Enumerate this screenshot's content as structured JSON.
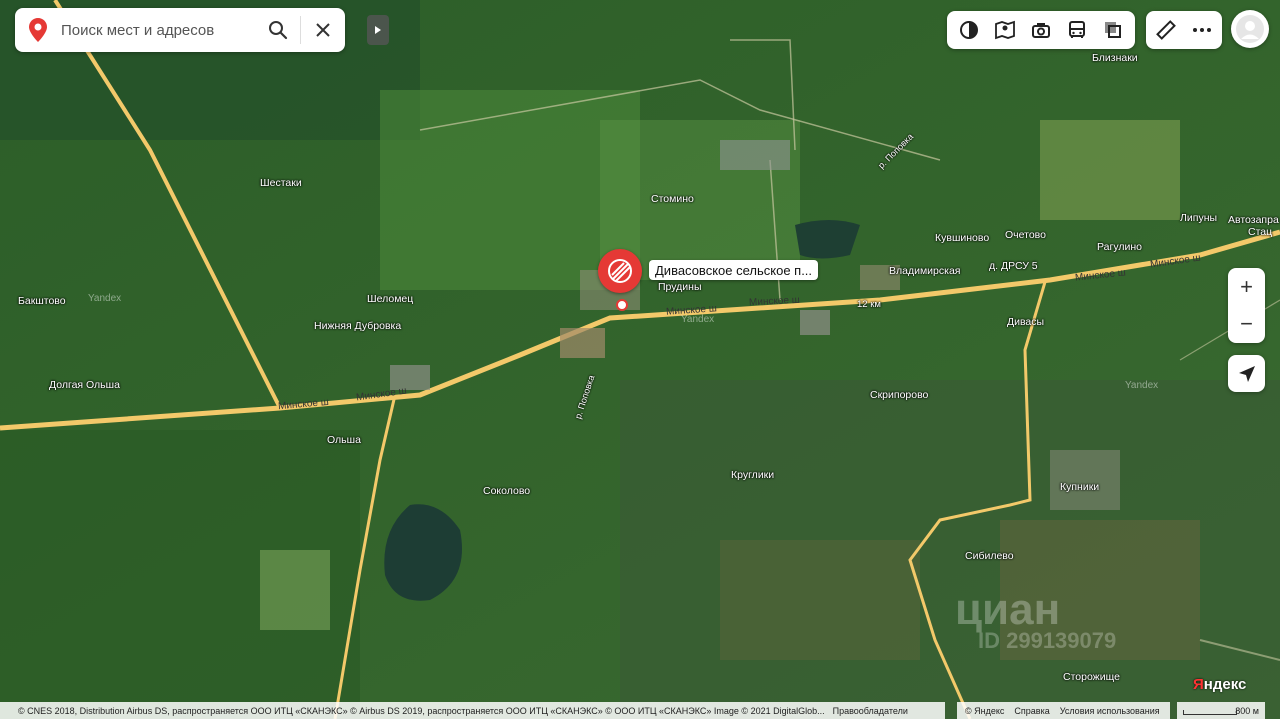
{
  "search": {
    "placeholder": "Поиск мест и адресов"
  },
  "place": {
    "name": "Дивасовское сельское п..."
  },
  "labels": [
    {
      "id": "shestaki",
      "text": "Шестаки"
    },
    {
      "id": "bakshtovo",
      "text": "Бакштово"
    },
    {
      "id": "shelomets",
      "text": "Шеломец"
    },
    {
      "id": "nizhnyaya",
      "text": "Нижняя Дубровка"
    },
    {
      "id": "dolgaya",
      "text": "Долгая Ольша"
    },
    {
      "id": "olsha",
      "text": "Ольша"
    },
    {
      "id": "stomino",
      "text": "Стомино"
    },
    {
      "id": "pruding",
      "text": "Прудины"
    },
    {
      "id": "sokolovo",
      "text": "Соколово"
    },
    {
      "id": "krugliki",
      "text": "Круглики"
    },
    {
      "id": "skriporovo",
      "text": "Скрипорово"
    },
    {
      "id": "kuvshinovo",
      "text": "Кувшиново"
    },
    {
      "id": "ochetovo",
      "text": "Очетово"
    },
    {
      "id": "ragulino",
      "text": "Рагулино"
    },
    {
      "id": "vladimirskaya",
      "text": "Владимирская"
    },
    {
      "id": "drsu",
      "text": "д. ДРСУ 5"
    },
    {
      "id": "divasy",
      "text": "Дивасы"
    },
    {
      "id": "lipuny",
      "text": "Липуны"
    },
    {
      "id": "azs",
      "text": "Автозапра"
    },
    {
      "id": "stan",
      "text": "Стац"
    },
    {
      "id": "bliznaki",
      "text": "Близнаки"
    },
    {
      "id": "kupniki",
      "text": "Купники"
    },
    {
      "id": "sibilevo",
      "text": "Сибилево"
    },
    {
      "id": "storozhische",
      "text": "Сторожище"
    },
    {
      "id": "popovka1",
      "text": "р. Поповка"
    },
    {
      "id": "popovka2",
      "text": "р. Поповка"
    }
  ],
  "roads": [
    {
      "id": "r1",
      "text": "Минское ш"
    },
    {
      "id": "r2",
      "text": "Минское ш"
    },
    {
      "id": "r3",
      "text": "Минское ш"
    },
    {
      "id": "r4",
      "text": "Минское ш"
    },
    {
      "id": "r5",
      "text": "Минское ш"
    },
    {
      "id": "r6",
      "text": "Минское ш"
    },
    {
      "id": "km",
      "text": "12 км"
    }
  ],
  "watermark": {
    "brand": "циан",
    "id": "ID 299139079"
  },
  "yandex_marks": [
    "Yandex",
    "Yandex",
    "Yandex"
  ],
  "footer": {
    "copyright": "© CNES 2018, Distribution Airbus DS, распространяется ООО ИТЦ «СКАНЭКС» © Airbus DS 2019, распространяется ООО ИТЦ «СКАНЭКС» © ООО ИТЦ «СКАНЭКС» Image © 2021 DigitalGlob...",
    "legal": "Правообладатели",
    "yandex": "© Яндекс",
    "help": "Справка",
    "terms": "Условия использования",
    "scale": "800 м"
  },
  "logo": {
    "first": "Я",
    "rest": "ндекс"
  },
  "zoom": {
    "in": "+",
    "out": "−"
  },
  "colors": {
    "marker": "#e53935",
    "road": "#f3c96a",
    "pin": "#e53935"
  }
}
